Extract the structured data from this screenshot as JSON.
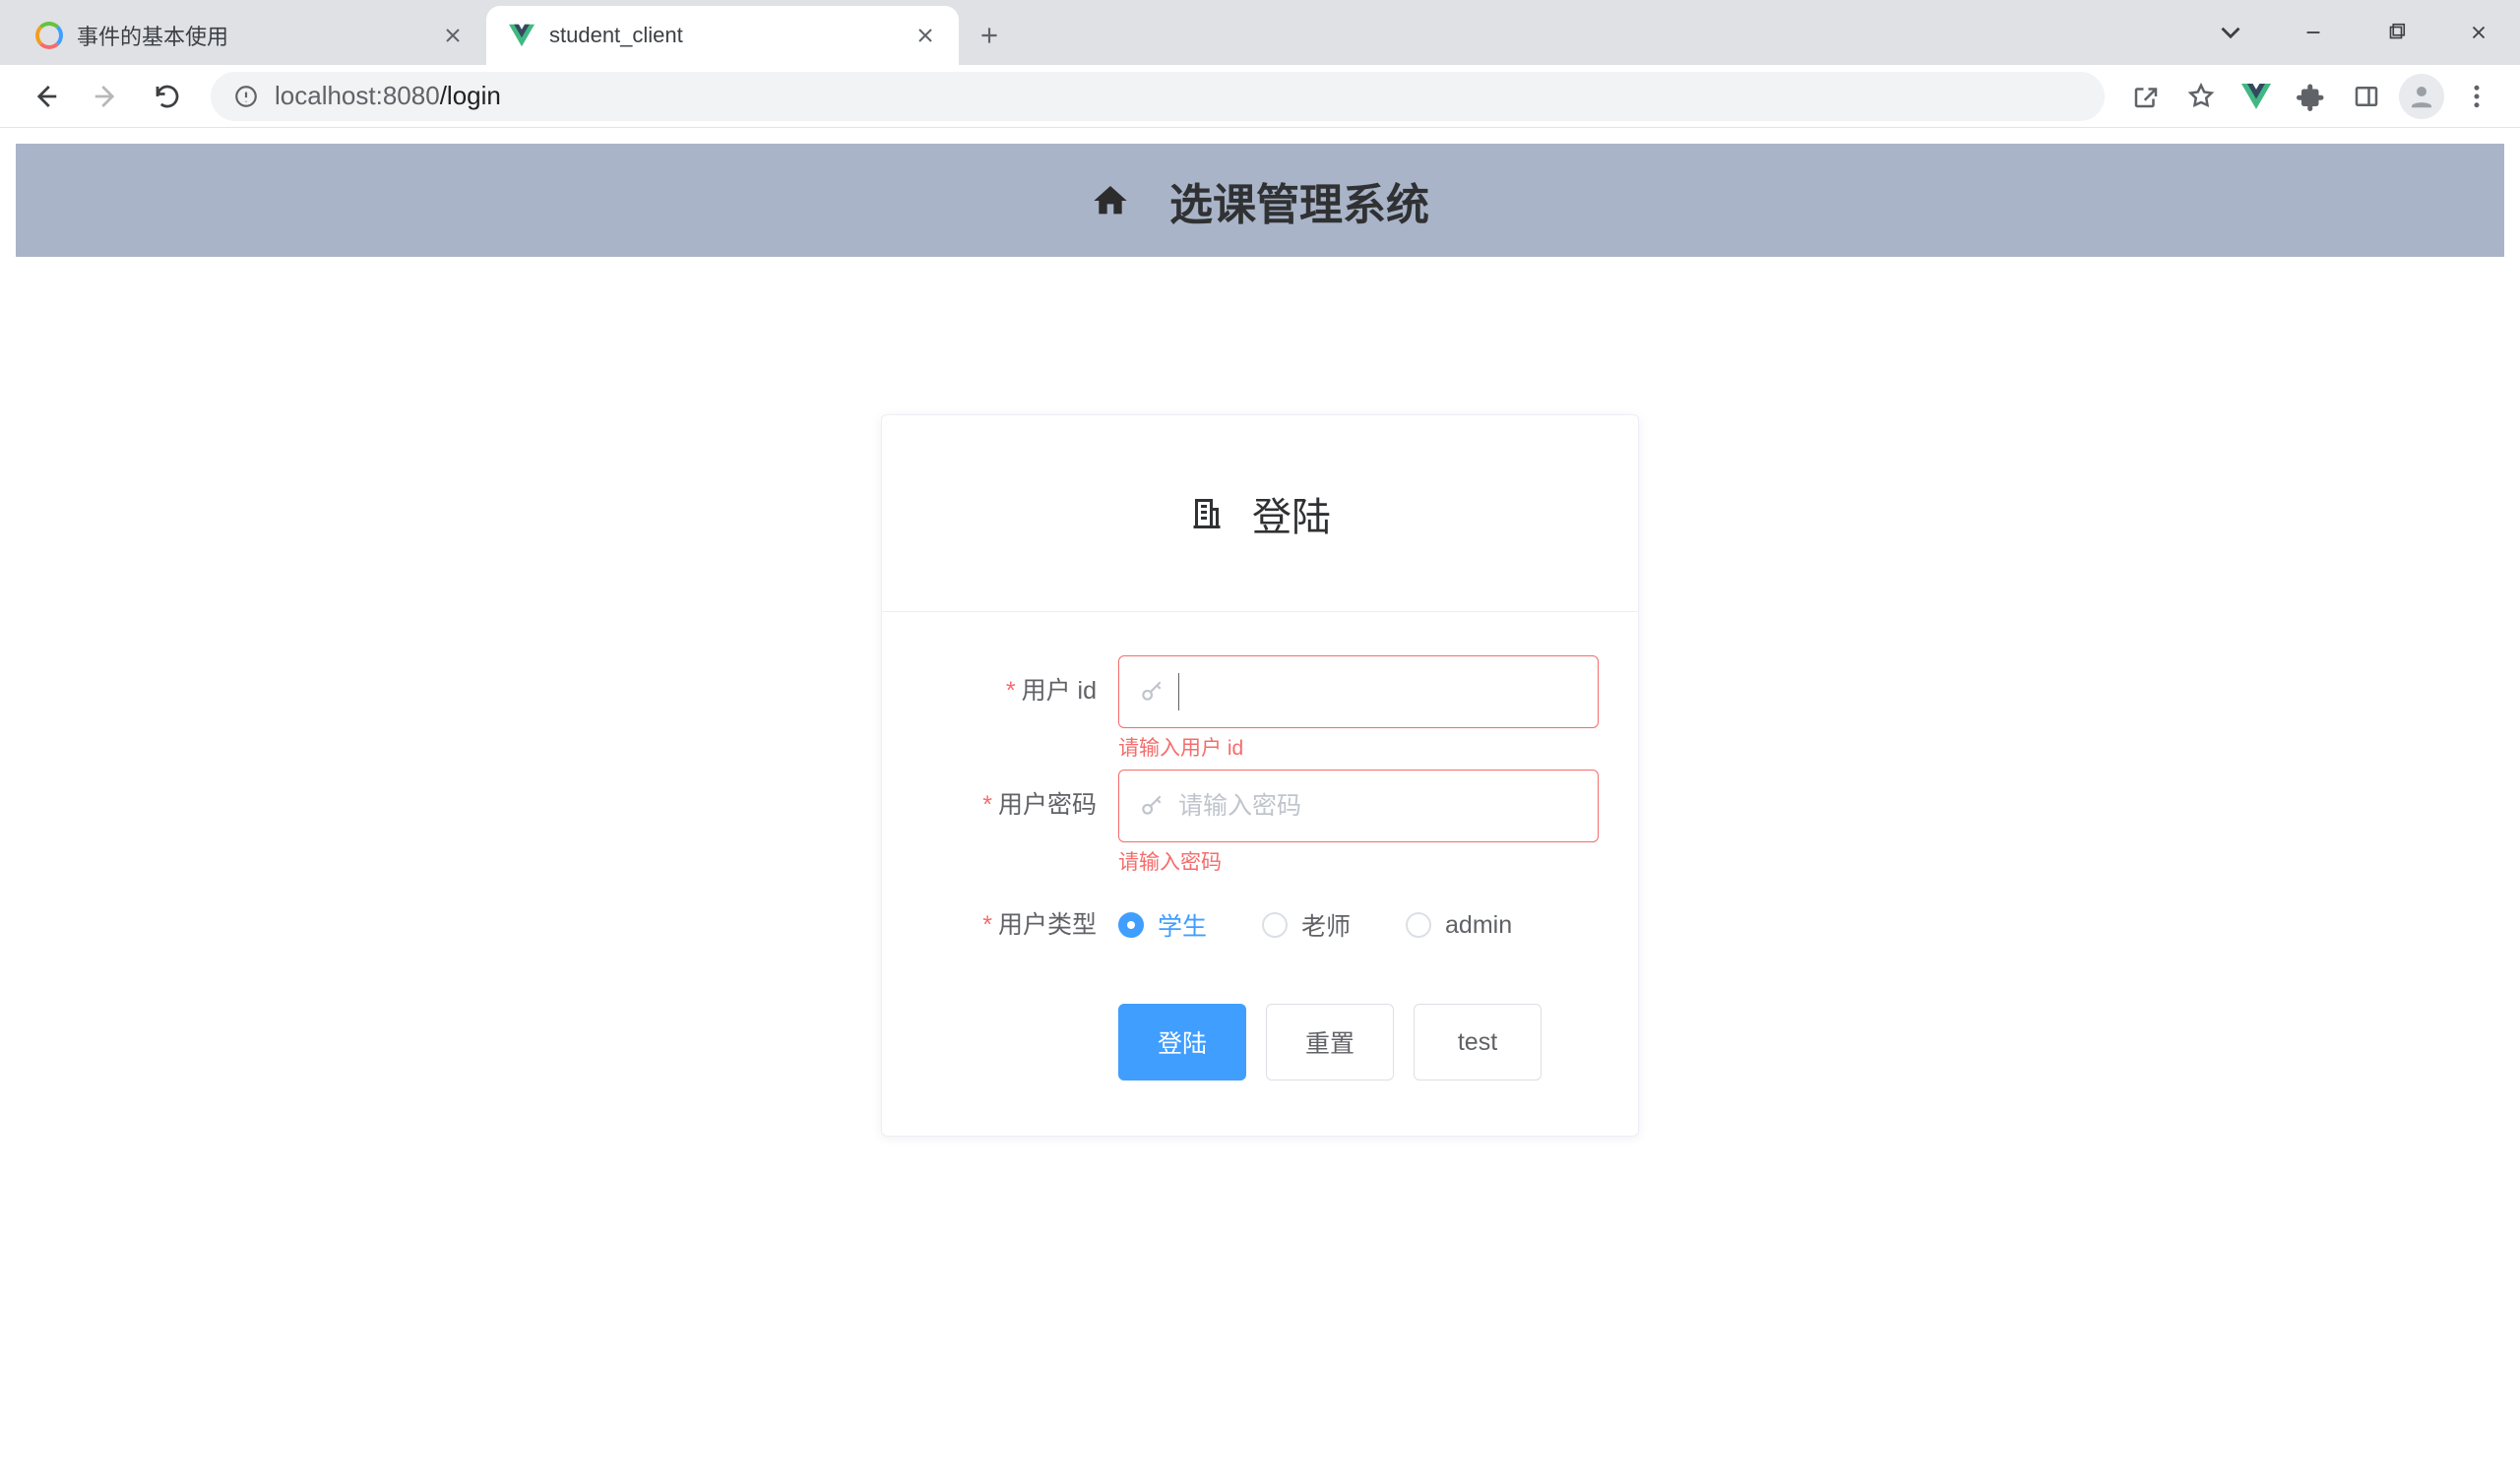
{
  "browser": {
    "tabs": [
      {
        "title": "事件的基本使用",
        "active": false
      },
      {
        "title": "student_client",
        "active": true
      }
    ],
    "url_host": "localhost",
    "url_port": ":8080",
    "url_path": "/login"
  },
  "banner": {
    "title": "选课管理系统"
  },
  "login": {
    "card_title": "登陆",
    "fields": {
      "uid": {
        "label": "用户 id",
        "placeholder": "",
        "error": "请输入用户 id"
      },
      "pwd": {
        "label": "用户密码",
        "placeholder": "请输入密码",
        "error": "请输入密码"
      },
      "type": {
        "label": "用户类型",
        "options": [
          "学生",
          "老师",
          "admin"
        ],
        "selected": "学生"
      }
    },
    "buttons": {
      "submit": "登陆",
      "reset": "重置",
      "test": "test"
    }
  }
}
